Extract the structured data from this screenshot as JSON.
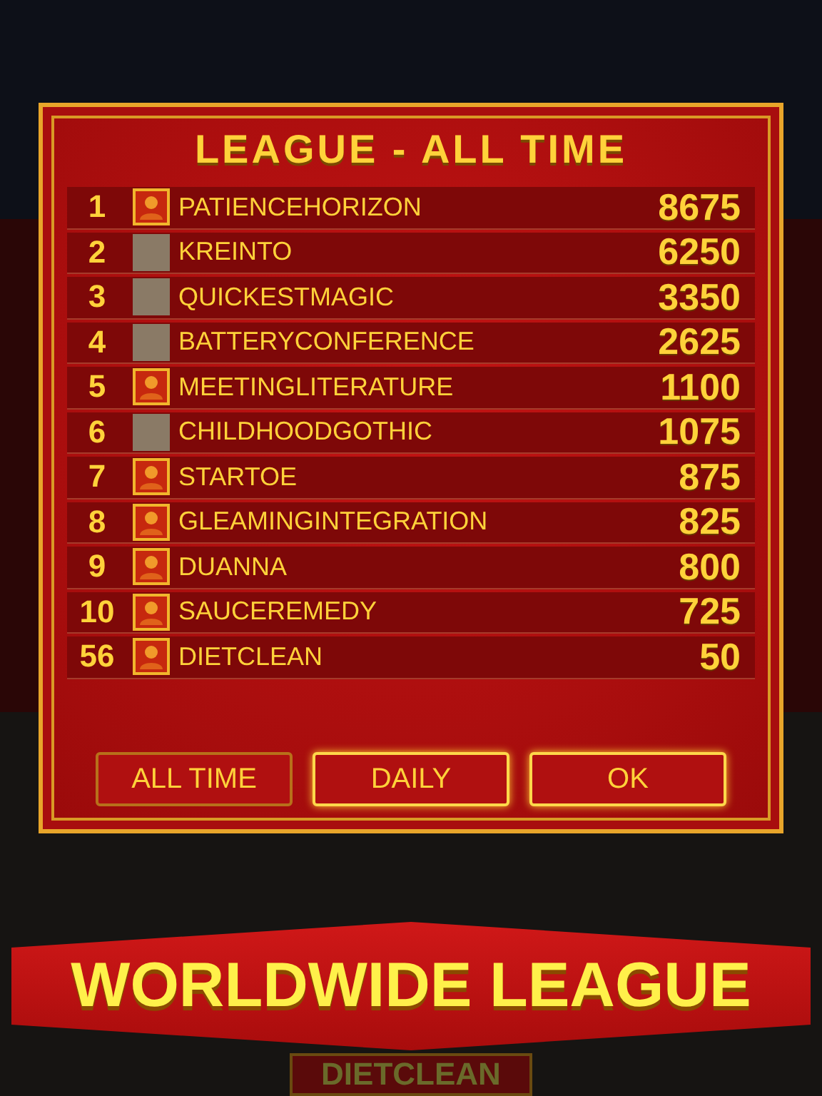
{
  "dialog": {
    "title": "LEAGUE - ALL TIME",
    "rows": [
      {
        "rank": "1",
        "kind": "default",
        "name": "PATIENCEHORIZON",
        "score": "8675"
      },
      {
        "rank": "2",
        "kind": "photo",
        "name": "KREINTO",
        "score": "6250"
      },
      {
        "rank": "3",
        "kind": "photo",
        "name": "QUICKESTMAGIC",
        "score": "3350"
      },
      {
        "rank": "4",
        "kind": "photo",
        "name": "BATTERYCONFERENCE",
        "score": "2625"
      },
      {
        "rank": "5",
        "kind": "default",
        "name": "MEETINGLITERATURE",
        "score": "1100"
      },
      {
        "rank": "6",
        "kind": "photo",
        "name": "CHILDHOODGOTHIC",
        "score": "1075"
      },
      {
        "rank": "7",
        "kind": "default",
        "name": "STARTOE",
        "score": "875"
      },
      {
        "rank": "8",
        "kind": "default",
        "name": "GLEAMINGINTEGRATION",
        "score": "825"
      },
      {
        "rank": "9",
        "kind": "default",
        "name": "DUANNA",
        "score": "800"
      },
      {
        "rank": "10",
        "kind": "default",
        "name": "SAUCEREMEDY",
        "score": "725"
      },
      {
        "rank": "56",
        "kind": "default",
        "name": "DIETCLEAN",
        "score": "50"
      }
    ],
    "buttons": [
      {
        "label": "ALL TIME",
        "selected": true
      },
      {
        "label": "DAILY",
        "selected": false
      },
      {
        "label": "OK",
        "selected": false
      }
    ]
  },
  "banner": {
    "text": "WORLDWIDE LEAGUE"
  },
  "background_label": "DIETCLEAN"
}
